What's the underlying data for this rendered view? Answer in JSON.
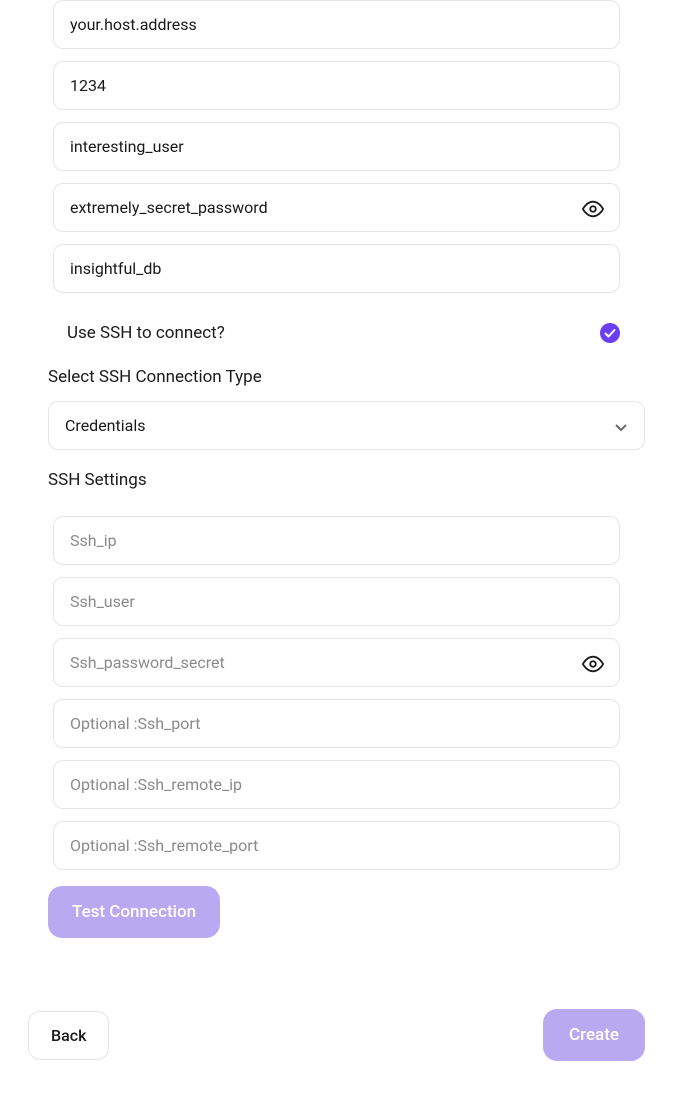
{
  "connection": {
    "host": "your.host.address",
    "port": "1234",
    "user": "interesting_user",
    "password": "extremely_secret_password",
    "database": "insightful_db"
  },
  "ssh": {
    "toggle_label": "Use SSH to connect?",
    "type_label": "Select SSH Connection Type",
    "type_value": "Credentials",
    "settings_label": "SSH Settings",
    "ip_placeholder": "Ssh_ip",
    "user_placeholder": "Ssh_user",
    "password_placeholder": "Ssh_password_secret",
    "port_placeholder": "Optional :Ssh_port",
    "remote_ip_placeholder": "Optional :Ssh_remote_ip",
    "remote_port_placeholder": "Optional :Ssh_remote_port"
  },
  "buttons": {
    "test": "Test Connection",
    "back": "Back",
    "create": "Create"
  }
}
